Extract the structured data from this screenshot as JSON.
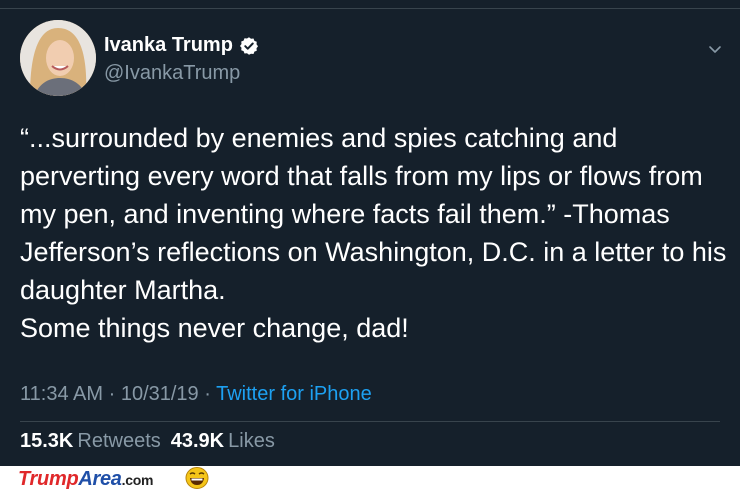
{
  "tweet": {
    "author": {
      "name": "Ivanka Trump",
      "handle": "@IvankaTrump"
    },
    "text_lines": [
      "“...surrounded by enemies and spies catching and",
      "perverting every word that falls from my lips or flows from",
      "my pen, and inventing where facts fail them.” -Thomas",
      "Jefferson’s reflections on Washington, D.C. in a letter to his",
      "daughter Martha.",
      "Some things never change, dad!"
    ],
    "time": "11:34 AM",
    "separator": "·",
    "date": "10/31/19",
    "source": "Twitter for iPhone",
    "stats": {
      "retweets_count": "15.3K",
      "retweets_label": "Retweets",
      "likes_count": "43.9K",
      "likes_label": "Likes"
    }
  },
  "watermark": {
    "brand_part1": "Trump",
    "brand_part2": "Area",
    "brand_suffix": ".com"
  },
  "colors": {
    "background": "#15202b",
    "text": "#ffffff",
    "secondary_text": "#8899a6",
    "link": "#1da1f2",
    "divider": "#38444d"
  },
  "icons": [
    "verified-badge-icon",
    "chevron-down-icon",
    "laughing-emoji-icon"
  ]
}
